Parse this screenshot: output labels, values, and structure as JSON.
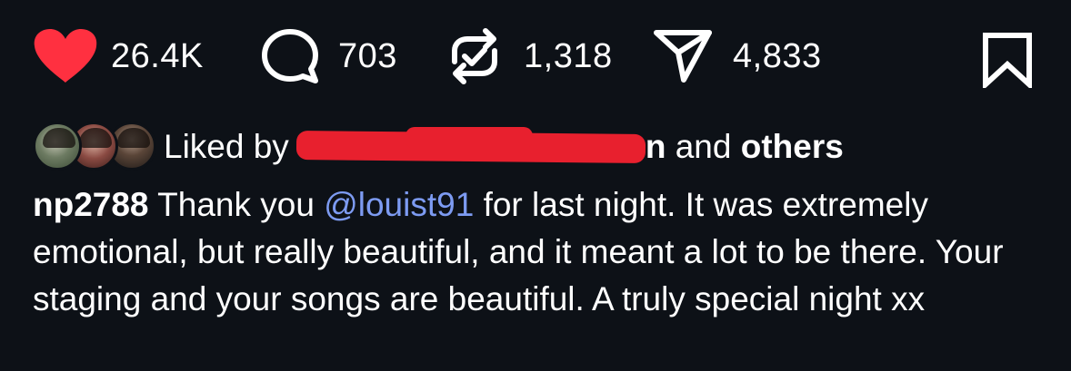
{
  "actions": {
    "likes": "26.4K",
    "comments": "703",
    "reposts": "1,318",
    "shares": "4,833"
  },
  "icons": {
    "like": "heart-icon",
    "comment": "comment-bubble-icon",
    "repost": "repost-icon",
    "share": "send-icon",
    "save": "bookmark-icon"
  },
  "colors": {
    "background": "#0d1117",
    "like": "#ff3040",
    "mention": "#7d9bf2",
    "redaction": "#e8202e"
  },
  "liked_by": {
    "prefix": "Liked by",
    "visible_name_end": "n",
    "middle": "and",
    "others": "others"
  },
  "caption": {
    "username": "np2788",
    "line1_before_mention": "Thank you",
    "mention": "@louist91",
    "rest": "for last night. It was extremely emotional, but really beautiful, and it meant a lot to be there. Your staging and your songs are beautiful. A truly special night xx"
  }
}
